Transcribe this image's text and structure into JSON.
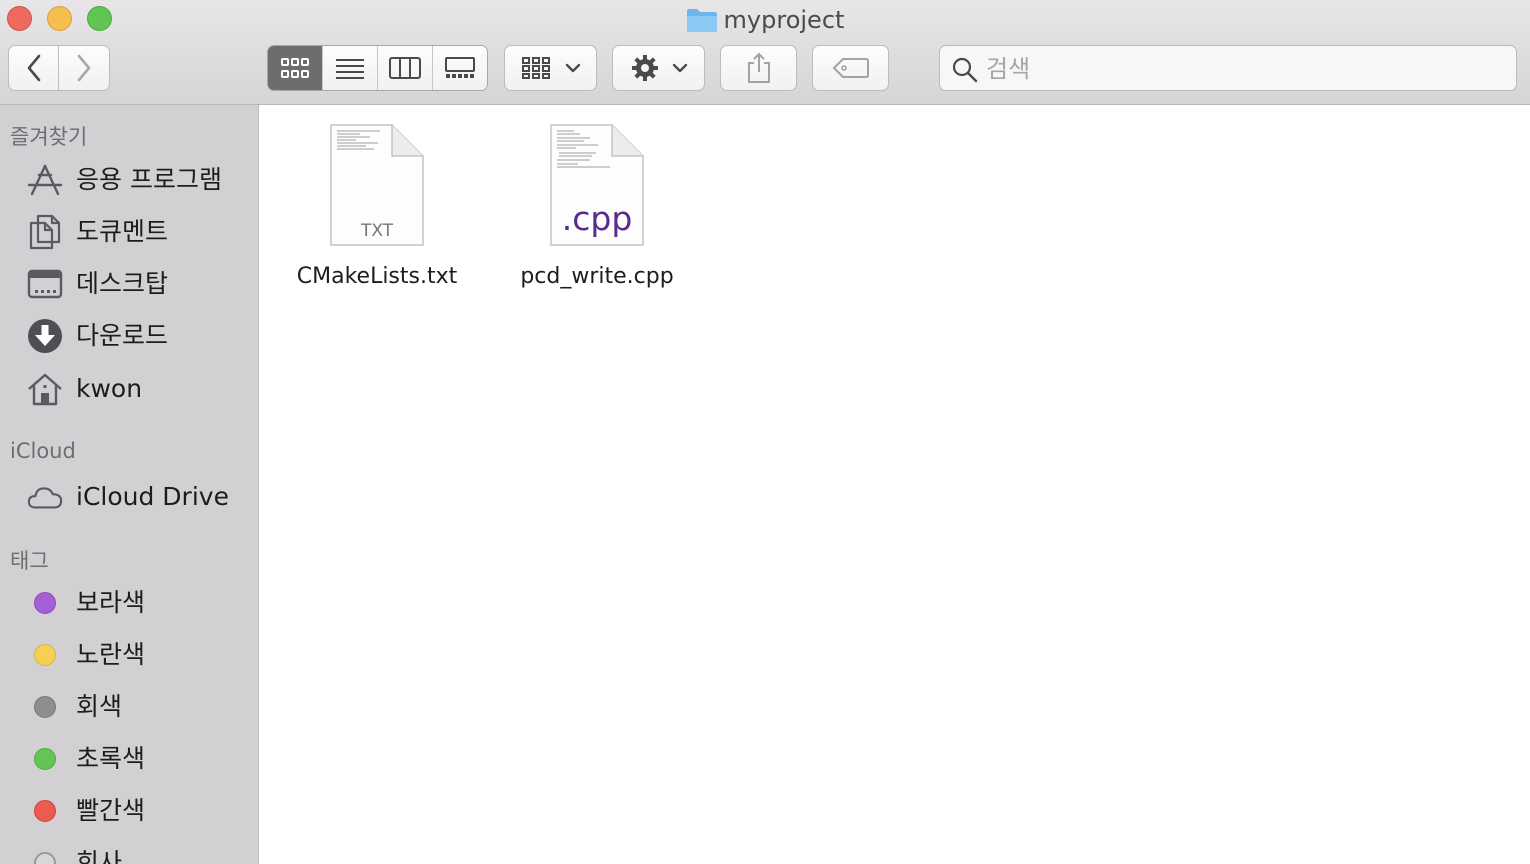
{
  "window": {
    "title": "myproject"
  },
  "toolbar": {
    "back_icon": "chevron-left-icon",
    "forward_icon": "chevron-right-icon",
    "view_modes": [
      "icon-view",
      "list-view",
      "column-view",
      "gallery-view"
    ],
    "active_view": "icon-view",
    "group_icon": "group-grid-icon",
    "action_icon": "gear-icon",
    "share_icon": "share-icon",
    "tag_icon": "tag-icon"
  },
  "search": {
    "placeholder": "검색"
  },
  "sidebar": {
    "favorites_header": "즐겨찾기",
    "favorites": [
      {
        "label": "응용 프로그램",
        "icon": "applications-icon"
      },
      {
        "label": "도큐멘트",
        "icon": "documents-icon"
      },
      {
        "label": "데스크탑",
        "icon": "desktop-icon"
      },
      {
        "label": "다운로드",
        "icon": "downloads-icon"
      },
      {
        "label": "kwon",
        "icon": "home-icon"
      }
    ],
    "icloud_header": "iCloud",
    "icloud": [
      {
        "label": "iCloud Drive",
        "icon": "cloud-icon"
      }
    ],
    "tags_header": "태그",
    "tags": [
      {
        "label": "보라색",
        "color": "#a55fd6"
      },
      {
        "label": "노란색",
        "color": "#f6cf55"
      },
      {
        "label": "회색",
        "color": "#8e8e90"
      },
      {
        "label": "초록색",
        "color": "#63c554"
      },
      {
        "label": "빨간색",
        "color": "#ec5a52"
      },
      {
        "label": "회사",
        "color": "#d8d8d8"
      }
    ]
  },
  "files": [
    {
      "name": "CMakeLists.txt",
      "badge": "TXT"
    },
    {
      "name": "pcd_write.cpp",
      "badge": ".cpp"
    }
  ],
  "colors": {
    "cpp_badge": "#5a2a8c",
    "txt_badge": "#777777"
  }
}
